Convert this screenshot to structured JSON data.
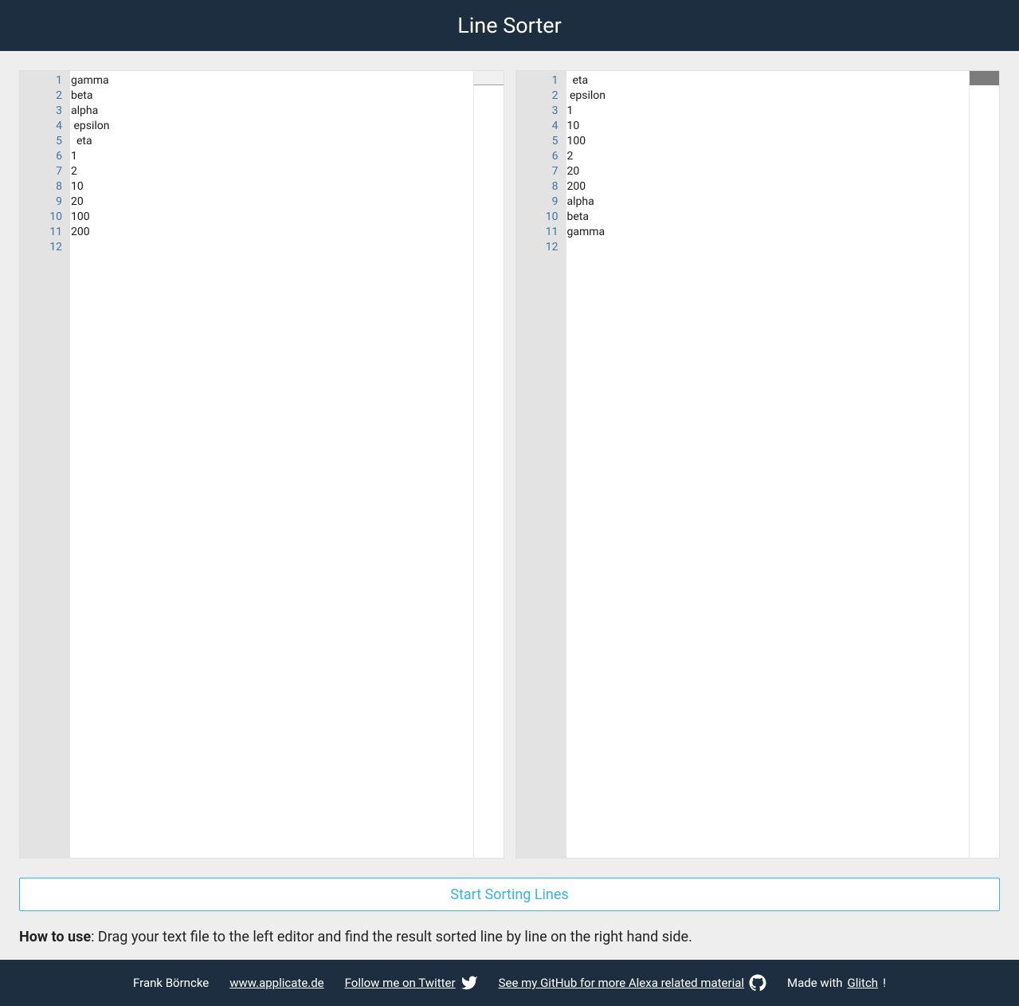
{
  "header": {
    "title": "Line Sorter"
  },
  "editor_left": {
    "lines": [
      "",
      "gamma",
      "beta",
      "alpha",
      " epsilon",
      "  eta",
      "1",
      "2",
      "10",
      "20",
      "100",
      "200"
    ]
  },
  "editor_right": {
    "lines": [
      "",
      "  eta",
      " epsilon",
      "1",
      "10",
      "100",
      "2",
      "20",
      "200",
      "alpha",
      "beta",
      "gamma"
    ]
  },
  "button": {
    "sort_label": "Start Sorting Lines"
  },
  "instructions": {
    "label": "How to use",
    "text": ": Drag your text file to the left editor and find the result sorted line by line on the right hand side."
  },
  "footer": {
    "author": "Frank Börncke",
    "website": "www.applicate.de",
    "twitter": "Follow me on Twitter",
    "github": "See my GitHub for more Alexa related material",
    "made_with_prefix": "Made with ",
    "made_with_link": "Glitch",
    "made_with_suffix": "!"
  }
}
